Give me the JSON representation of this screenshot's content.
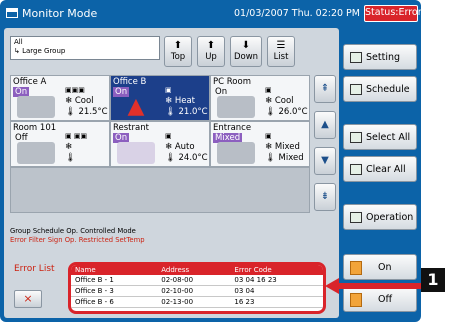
{
  "titlebar": {
    "title": "Monitor Mode",
    "datetime": "01/03/2007 Thu. 02:20 PM",
    "status": "Status:Error"
  },
  "group": {
    "line1": "All",
    "line2": "Large Group"
  },
  "nav": [
    {
      "label": "Top",
      "icon": "up-arrow"
    },
    {
      "label": "Up",
      "icon": "up-arrow"
    },
    {
      "label": "Down",
      "icon": "down-arrow"
    },
    {
      "label": "List",
      "icon": "list"
    }
  ],
  "units": [
    {
      "name": "Office A",
      "state": "On",
      "mode": "Cool",
      "temp": "21.5°C"
    },
    {
      "name": "Office B",
      "state": "On",
      "mode": "Heat",
      "temp": "21.0°C"
    },
    {
      "name": "PC Room",
      "state": "On",
      "mode": "Cool",
      "temp": "26.0°C"
    },
    {
      "name": "Room 101",
      "state": "Off",
      "mode": "",
      "temp": ""
    },
    {
      "name": "Restrant",
      "state": "On",
      "mode": "Auto",
      "temp": "24.0°C"
    },
    {
      "name": "Entrance",
      "state": "Mixed",
      "mode": "Mixed",
      "temp": "Mixed"
    }
  ],
  "legend": {
    "line1": "Group  Schedule  Op. Controlled  Mode",
    "line2": "Error  Filter Sign  Op. Restricted  SetTemp"
  },
  "errors": {
    "label": "Error List",
    "close_label": "×",
    "headers": [
      "Name",
      "Address",
      "Error Code"
    ],
    "rows": [
      [
        "Office B - 1",
        "02-08-00",
        "03 04 16 23"
      ],
      [
        "Office B - 3",
        "02-10-00",
        "03 04"
      ],
      [
        "Office B - 6",
        "02-13-00",
        "16 23"
      ]
    ]
  },
  "side_buttons": {
    "setting": "Setting",
    "schedule": "Schedule",
    "select_all": "Select All",
    "clear_all": "Clear All",
    "operation": "Operation",
    "on": "On",
    "off": "Off"
  },
  "callout": {
    "number": "1"
  },
  "colors": {
    "frame": "#0c63a8",
    "error": "#d9242a",
    "selected": "#1c3f8a"
  }
}
